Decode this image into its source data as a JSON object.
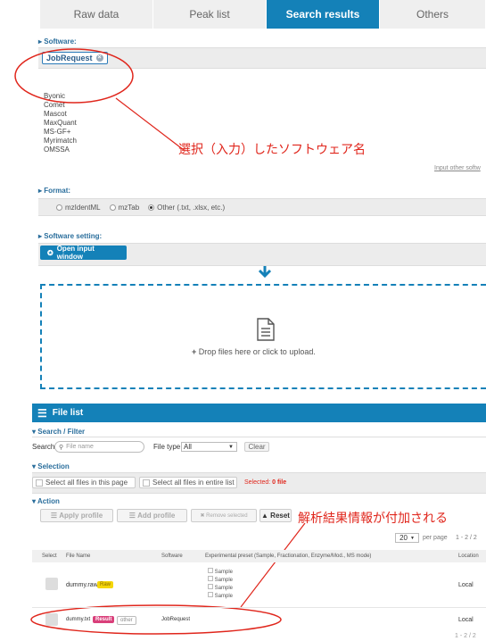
{
  "tabs": [
    "Raw data",
    "Peak list",
    "Search results",
    "Others"
  ],
  "software": {
    "heading": "Software:",
    "selected_chip": "JobRequest",
    "list": [
      "Byonic",
      "Comet",
      "Mascot",
      "MaxQuant",
      "MS-GF+",
      "Myrimatch",
      "OMSSA"
    ],
    "input_other": "Input other softw",
    "annotation": "選択（入力）したソフトウェア名"
  },
  "format": {
    "heading": "Format:",
    "options": [
      "mzIdentML",
      "mzTab",
      "Other (.txt, .xlsx, etc.)"
    ]
  },
  "software_setting": {
    "heading": "Software setting:",
    "open_button": "Open input window"
  },
  "dropzone": {
    "text": "Drop files here or click to upload."
  },
  "file_list": {
    "title": "File list",
    "search_filter": "Search / Filter",
    "search_label": "Search",
    "search_placeholder": "File name",
    "file_type_label": "File type",
    "file_type_value": "All",
    "clear_button": "Clear",
    "selection_heading": "Selection",
    "select_page": "Select all files in this page",
    "select_all": "Select all files in entire list",
    "selected_prefix": "Selected:",
    "selected_count": "0 file",
    "action_heading": "Action",
    "apply_profile": "Apply profile",
    "add_profile": "Add profile",
    "remove_selected": "Remove selected",
    "reset": "Reset",
    "annotation": "解析結果情報が付加される",
    "per_page_value": "20",
    "per_page_label": "per page",
    "range": "1 - 2 / 2",
    "range_bottom": "1 - 2 / 2",
    "columns": [
      "Select",
      "File Name",
      "Software",
      "Experimental preset (Sample, Fractionation, Enzyme/Mod., MS mode)",
      "Location"
    ],
    "rows": [
      {
        "name": "dummy.raw",
        "tag": "Raw",
        "software": "",
        "presets": [
          "Sample",
          "Sample",
          "Sample",
          "Sample"
        ],
        "location": "Local"
      },
      {
        "name": "dummy.txt",
        "tag": "Result",
        "extra_tag": "other",
        "software": "JobRequest",
        "presets": [],
        "location": "Local"
      }
    ]
  },
  "colors": {
    "accent": "#1481b8",
    "annotation_red": "#e0261c",
    "raw_tag": "#f5d60a",
    "result_tag": "#d93f7a"
  }
}
